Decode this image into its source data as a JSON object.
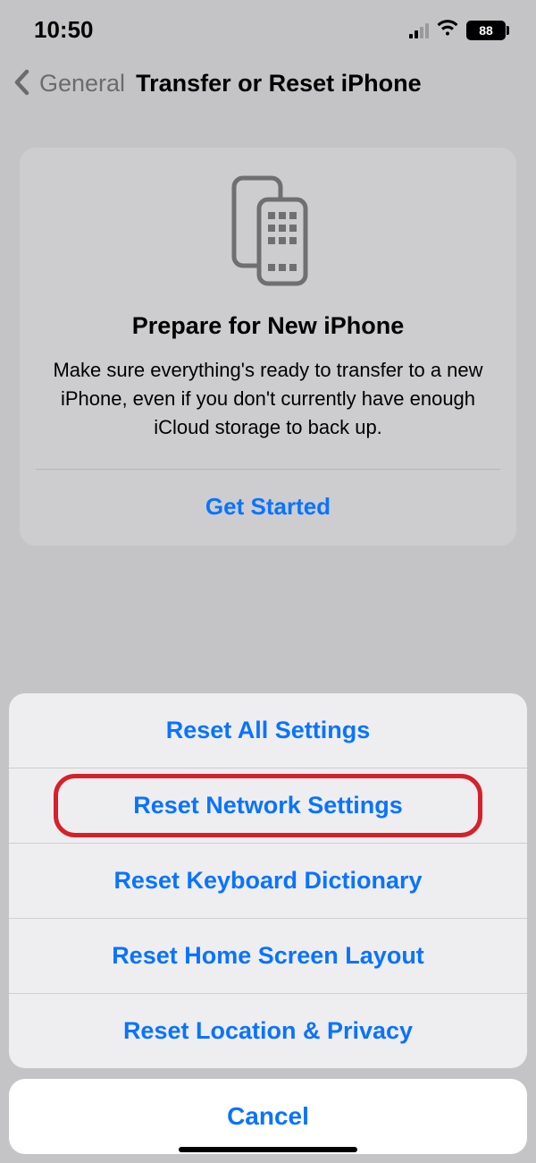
{
  "status": {
    "time": "10:50",
    "battery_percent": "88"
  },
  "nav": {
    "back_label": "General",
    "title": "Transfer or Reset iPhone"
  },
  "card": {
    "title": "Prepare for New iPhone",
    "body": "Make sure everything's ready to transfer to a new iPhone, even if you don't currently have enough iCloud storage to back up.",
    "cta": "Get Started"
  },
  "sheet": {
    "items": [
      "Reset All Settings",
      "Reset Network Settings",
      "Reset Keyboard Dictionary",
      "Reset Home Screen Layout",
      "Reset Location & Privacy"
    ],
    "highlighted_index": 1,
    "cancel": "Cancel"
  },
  "colors": {
    "link": "#0a73ff",
    "highlight": "#d6202a",
    "bg": "#c4c4c6"
  }
}
